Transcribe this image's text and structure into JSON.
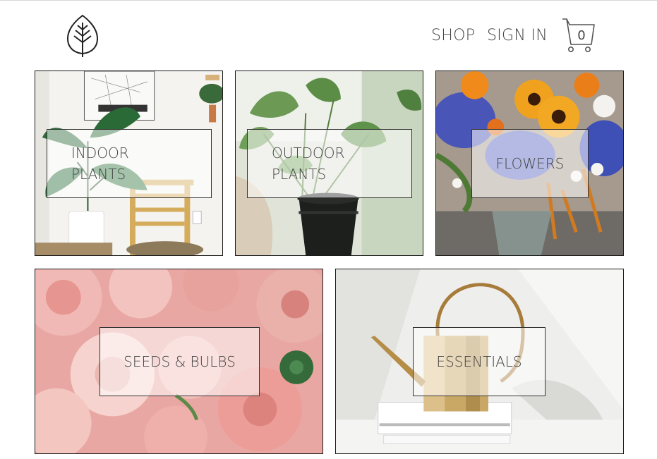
{
  "header": {
    "logo_icon": "leaf-icon",
    "nav": {
      "shop": "SHOP",
      "signin": "SIGN IN"
    },
    "cart": {
      "icon": "cart-icon",
      "count": "0"
    }
  },
  "tiles": [
    {
      "id": "indoor",
      "label": "INDOOR PLANTS",
      "image": "indoor-plant-photo"
    },
    {
      "id": "outdoor",
      "label": "OUTDOOR PLANTS",
      "image": "outdoor-plant-photo"
    },
    {
      "id": "flowers",
      "label": "FLOWERS",
      "image": "flowers-bouquet-photo"
    },
    {
      "id": "seeds",
      "label": "SEEDS & BULBS",
      "image": "pink-ranunculus-photo"
    },
    {
      "id": "essentials",
      "label": "ESSENTIALS",
      "image": "watering-can-photo"
    }
  ],
  "colors": {
    "text": "#444444",
    "border": "#1a1a1a",
    "rule": "#d7d7d7"
  }
}
